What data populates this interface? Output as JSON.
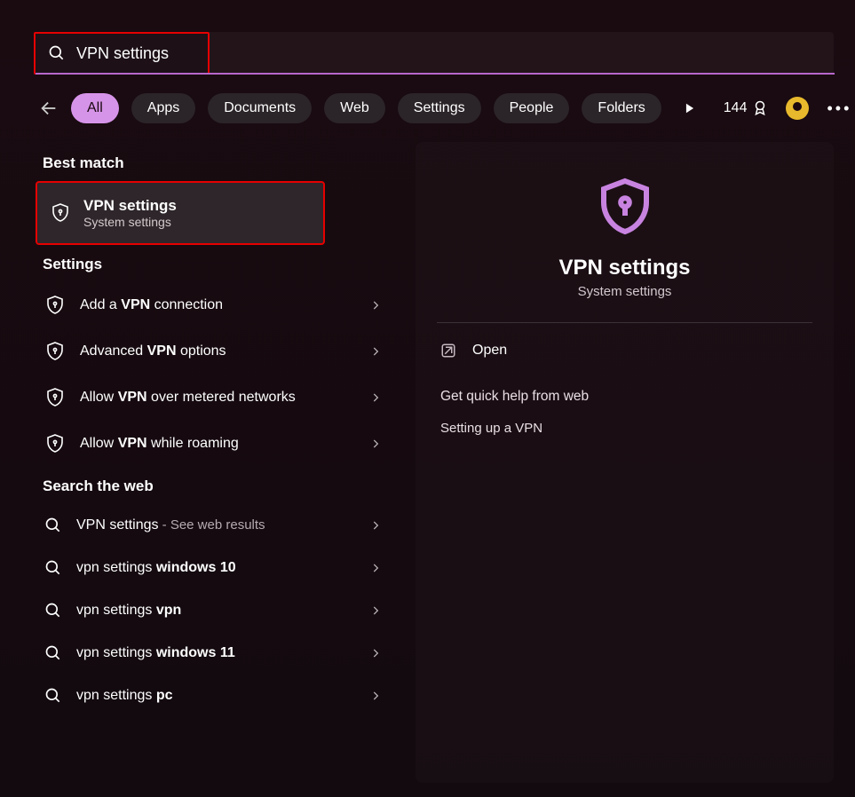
{
  "search": {
    "value": "VPN settings"
  },
  "filters": [
    "All",
    "Apps",
    "Documents",
    "Web",
    "Settings",
    "People",
    "Folders"
  ],
  "filters_active_index": 0,
  "points": "144",
  "left": {
    "section_best": "Best match",
    "best_match": {
      "title": "VPN settings",
      "subtitle": "System settings"
    },
    "section_settings": "Settings",
    "settings_items": [
      {
        "pre": "Add a ",
        "kw": "VPN",
        "post": " connection"
      },
      {
        "pre": "Advanced ",
        "kw": "VPN",
        "post": " options"
      },
      {
        "pre": "Allow ",
        "kw": "VPN",
        "post": " over metered networks"
      },
      {
        "pre": "Allow ",
        "kw": "VPN",
        "post": " while roaming"
      }
    ],
    "section_web": "Search the web",
    "web_items": [
      {
        "main": "VPN settings",
        "suffix": " - See web results"
      },
      {
        "pre": "vpn settings ",
        "kw": "windows 10"
      },
      {
        "pre": "vpn settings ",
        "kw": "vpn"
      },
      {
        "pre": "vpn settings ",
        "kw": "windows 11"
      },
      {
        "pre": "vpn settings ",
        "kw": "pc"
      }
    ]
  },
  "right": {
    "title": "VPN settings",
    "subtitle": "System settings",
    "open": "Open",
    "help_title": "Get quick help from web",
    "help_link": "Setting up a VPN"
  }
}
